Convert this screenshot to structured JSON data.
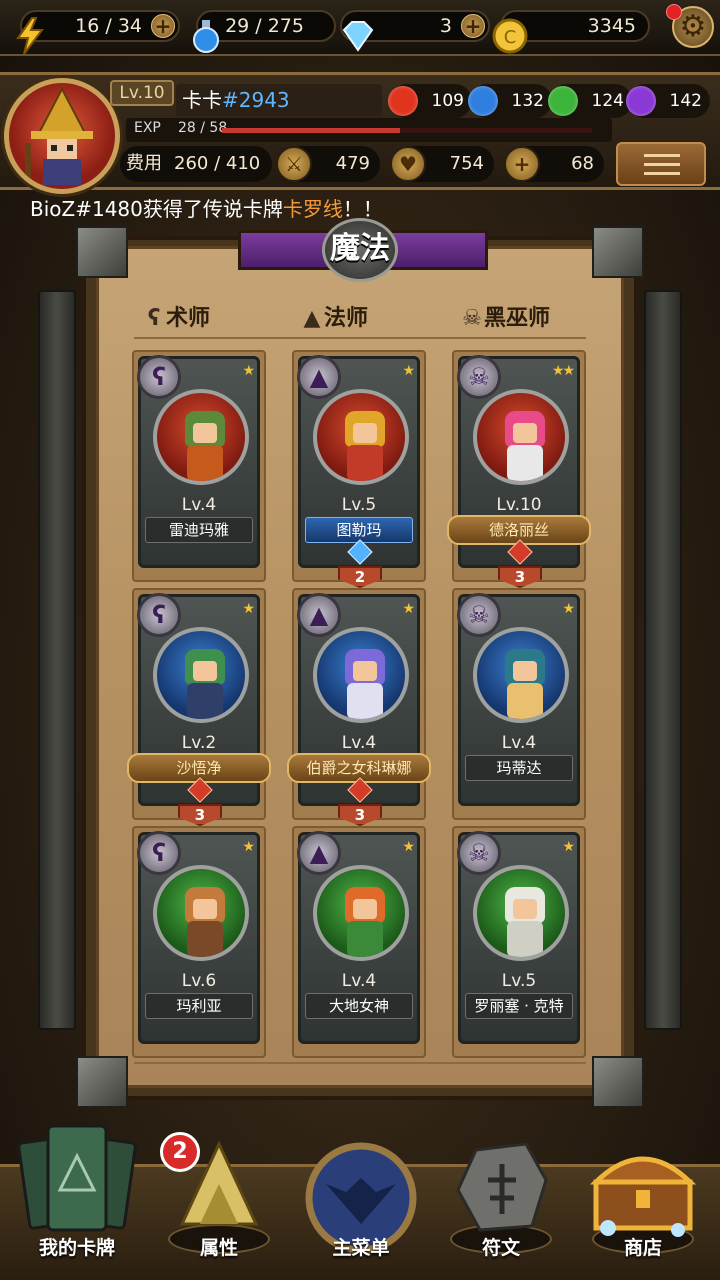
{
  "resources": {
    "energy": "16 / 34",
    "potion": "29 / 275",
    "gems": "3",
    "gold": "3345"
  },
  "player": {
    "level": "Lv.10",
    "name": "卡卡",
    "tag": "#2943",
    "exp_label": "EXP",
    "exp_value": "28 / 58",
    "exp_progress": 0.48,
    "cost_label": "费用",
    "cost_value": "260 / 410",
    "attack": "479",
    "hp": "754",
    "heal": "68",
    "elements": [
      {
        "name": "fire",
        "value": "109",
        "color": "#e0341e"
      },
      {
        "name": "water",
        "value": "132",
        "color": "#2f7fe0"
      },
      {
        "name": "nature",
        "value": "124",
        "color": "#3cb43a"
      },
      {
        "name": "dark",
        "value": "142",
        "color": "#8a38d6"
      }
    ]
  },
  "ticker": {
    "prefix": "BioZ#1480获得了传说卡牌",
    "highlight": "卡罗线",
    "suffix": "！！"
  },
  "board": {
    "title": "魔法",
    "columns": [
      {
        "label": "术师",
        "icon": "staff-icon"
      },
      {
        "label": "法师",
        "icon": "wizard-hat-icon"
      },
      {
        "label": "黑巫师",
        "icon": "skull-icon"
      }
    ]
  },
  "cards": [
    {
      "name": "雷迪玛雅",
      "level": "Lv.4",
      "stars": "★",
      "type": "sorcerer",
      "rarity": "common",
      "frame": "red",
      "count": ""
    },
    {
      "name": "图勒玛",
      "level": "Lv.5",
      "stars": "★",
      "type": "wizard",
      "rarity": "rare",
      "frame": "red",
      "count": "2"
    },
    {
      "name": "德洛丽丝",
      "level": "Lv.10",
      "stars": "★★",
      "type": "warlock",
      "rarity": "epic",
      "frame": "red",
      "count": "3"
    },
    {
      "name": "沙悟净",
      "level": "Lv.2",
      "stars": "★",
      "type": "sorcerer",
      "rarity": "epic",
      "frame": "blue",
      "count": "3"
    },
    {
      "name": "伯爵之女科琳娜",
      "level": "Lv.4",
      "stars": "★",
      "type": "wizard",
      "rarity": "epic",
      "frame": "blue",
      "count": "3"
    },
    {
      "name": "玛蒂达",
      "level": "Lv.4",
      "stars": "★",
      "type": "warlock",
      "rarity": "common",
      "frame": "blue",
      "count": ""
    },
    {
      "name": "玛利亚",
      "level": "Lv.6",
      "stars": "★",
      "type": "sorcerer",
      "rarity": "common",
      "frame": "green",
      "count": ""
    },
    {
      "name": "大地女神",
      "level": "Lv.4",
      "stars": "★",
      "type": "wizard",
      "rarity": "common",
      "frame": "green",
      "count": ""
    },
    {
      "name": "罗丽塞 · 克特",
      "level": "Lv.5",
      "stars": "★",
      "type": "warlock",
      "rarity": "common",
      "frame": "green",
      "count": ""
    }
  ],
  "nav": [
    {
      "label": "我的卡牌",
      "icon": "card-deck-icon"
    },
    {
      "label": "属性",
      "icon": "triforce-icon",
      "badge": "2"
    },
    {
      "label": "主菜单",
      "icon": "emblem-icon"
    },
    {
      "label": "符文",
      "icon": "rune-stone-icon"
    },
    {
      "label": "商店",
      "icon": "treasure-chest-icon"
    }
  ]
}
